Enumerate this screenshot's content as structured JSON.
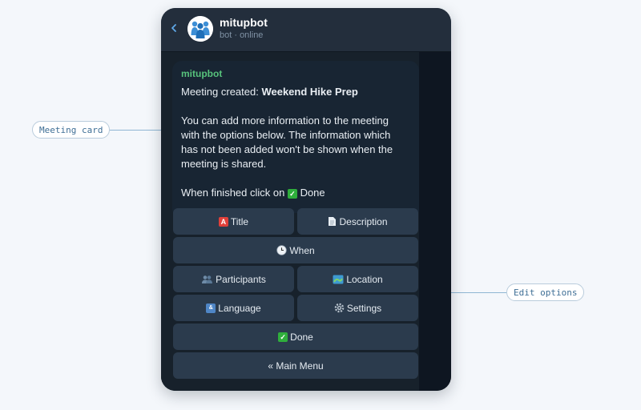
{
  "callouts": {
    "meeting_card": "Meeting card",
    "edit_options": "Edit options"
  },
  "header": {
    "name": "mitupbot",
    "status": "bot · online"
  },
  "message": {
    "sender": "mitupbot",
    "created_prefix": "Meeting created: ",
    "meeting_title": "Weekend Hike Prep",
    "info_lines": [
      "You can add more information to the meeting",
      "with the options below. The information which",
      "has not been added won't be shown when the",
      "meeting is shared."
    ],
    "finish_prefix": "When finished click on ",
    "finish_emoji": "✅",
    "finish_suffix": " Done"
  },
  "keyboard": {
    "title": {
      "label": "Title",
      "emoji": "🅰️"
    },
    "description": {
      "label": "Description",
      "emoji": "📄"
    },
    "when": {
      "label": "When",
      "emoji": "🕒"
    },
    "participants": {
      "label": "Participants",
      "emoji": "👥"
    },
    "location": {
      "label": "Location",
      "emoji": "🗺️"
    },
    "language": {
      "label": "Language",
      "emoji": "🔣"
    },
    "settings": {
      "label": "Settings",
      "emoji": "⚙️"
    },
    "done": {
      "label": "Done",
      "emoji": "✅"
    },
    "main_menu": {
      "label": "« Main Menu"
    }
  },
  "colors": {
    "accent": "#5fa8e8",
    "sender": "#57c27c",
    "button_bg": "#2b3b4d",
    "bubble_bg": "#182533"
  }
}
